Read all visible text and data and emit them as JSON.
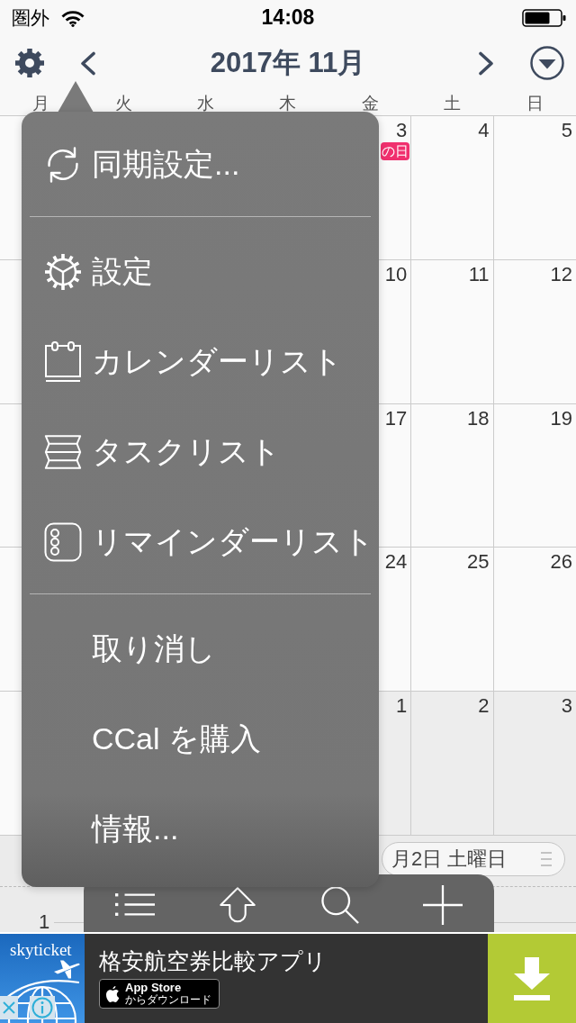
{
  "status_bar": {
    "carrier": "圏外",
    "time": "14:08"
  },
  "header": {
    "title": "2017年 11月"
  },
  "weekdays": [
    "月",
    "火",
    "水",
    "木",
    "金",
    "土",
    "日"
  ],
  "calendar": {
    "weeks": [
      {
        "days": [
          {
            "day": "3",
            "other_month": false,
            "events": [
              "の日"
            ]
          },
          {
            "day": "4",
            "other_month": false
          },
          {
            "day": "5",
            "other_month": false
          }
        ]
      },
      {
        "days": [
          {
            "day": "10",
            "other_month": false
          },
          {
            "day": "11",
            "other_month": false
          },
          {
            "day": "12",
            "other_month": false
          }
        ]
      },
      {
        "days": [
          {
            "day": "17",
            "other_month": false
          },
          {
            "day": "18",
            "other_month": false
          },
          {
            "day": "19",
            "other_month": false
          }
        ]
      },
      {
        "days": [
          {
            "day": "24",
            "other_month": false
          },
          {
            "day": "25",
            "other_month": false
          },
          {
            "day": "26",
            "other_month": false
          }
        ]
      },
      {
        "days": [
          {
            "day": "1",
            "other_month": true
          },
          {
            "day": "2",
            "other_month": true
          },
          {
            "day": "3",
            "other_month": true
          }
        ]
      }
    ]
  },
  "menu": {
    "sections": [
      {
        "items": [
          {
            "label": "同期設定...",
            "kind": "sync"
          }
        ]
      },
      {
        "items": [
          {
            "label": "設定",
            "kind": "settings"
          },
          {
            "label": "カレンダーリスト",
            "kind": "calendars"
          },
          {
            "label": "タスクリスト",
            "kind": "tasks"
          },
          {
            "label": "リマインダーリスト",
            "kind": "reminders"
          }
        ]
      },
      {
        "items": [
          {
            "label": "取り消し",
            "kind": "plain"
          },
          {
            "label": "CCal を購入",
            "kind": "plain"
          },
          {
            "label": "情報...",
            "kind": "plain"
          }
        ]
      }
    ]
  },
  "day_view": {
    "date": "月2日 土曜日",
    "hour": "1"
  },
  "toolbar": {
    "buttons": [
      {
        "kind": "list"
      },
      {
        "kind": "share"
      },
      {
        "kind": "search"
      },
      {
        "kind": "add"
      }
    ]
  },
  "ad": {
    "brand": "skyticket",
    "title": "格安航空券比較アプリ",
    "badge_title": "App Store",
    "badge_subtitle": "からダウンロード"
  }
}
